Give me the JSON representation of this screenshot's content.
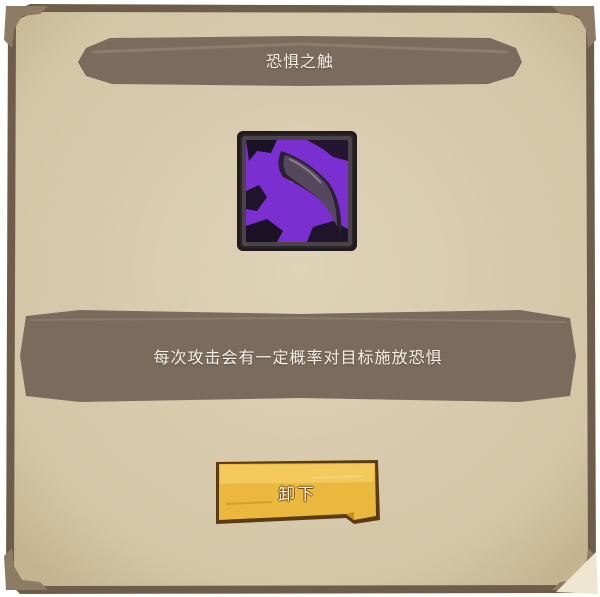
{
  "dialog": {
    "title": "恐惧之触",
    "description": "每次攻击会有一定概率对目标施放恐惧",
    "unequip_label": "卸下"
  },
  "skill": {
    "icon": "purple-claw-skill-icon",
    "theme_color": "#7b2fd0"
  },
  "colors": {
    "parchment": "#d8cbae",
    "banner": "#7a6b5c",
    "button": "#e9b83c"
  }
}
